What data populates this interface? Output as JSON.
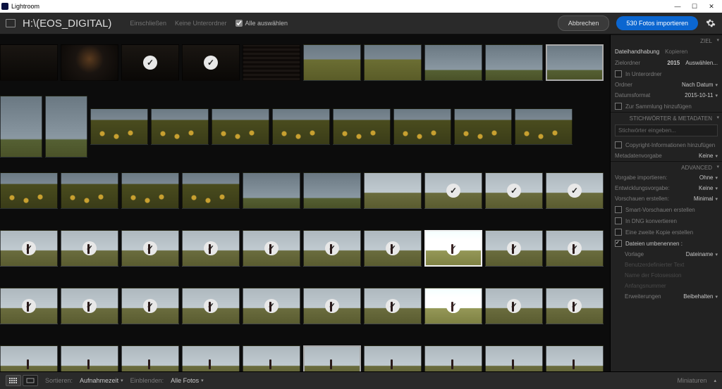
{
  "window": {
    "title": "Lightroom"
  },
  "topbar": {
    "path": "H:\\(EOS_DIGITAL)",
    "include": "Einschließen",
    "no_subfolders": "Keine Unterordner",
    "select_all": "Alle auswählen",
    "cancel": "Abbrechen",
    "import": "530 Fotos importieren"
  },
  "thumbs": {
    "rows": [
      [
        {
          "tex": "t-dark"
        },
        {
          "tex": "t-lamp"
        },
        {
          "tex": "t-dark",
          "check": true
        },
        {
          "tex": "t-dark",
          "check": true
        },
        {
          "tex": "t-mixer"
        },
        {
          "tex": "t-field"
        },
        {
          "tex": "t-field"
        },
        {
          "tex": "t-sky"
        },
        {
          "tex": "t-sky"
        },
        {
          "tex": "t-sky",
          "sel": true
        }
      ],
      [
        {
          "tex": "t-sky",
          "tall": true
        },
        {
          "tex": "t-sky",
          "tall": true
        },
        {
          "tex": "t-flowers"
        },
        {
          "tex": "t-flowers"
        },
        {
          "tex": "t-flowers"
        },
        {
          "tex": "t-flowers"
        },
        {
          "tex": "t-flowers"
        },
        {
          "tex": "t-flowers"
        },
        {
          "tex": "t-flowers"
        },
        {
          "tex": "t-flowers"
        }
      ],
      [
        {
          "tex": "t-flowers"
        },
        {
          "tex": "t-flowers"
        },
        {
          "tex": "t-flowers"
        },
        {
          "tex": "t-flowers"
        },
        {
          "tex": "t-sky"
        },
        {
          "tex": "t-sky"
        },
        {
          "tex": "t-path"
        },
        {
          "tex": "t-path",
          "check": true
        },
        {
          "tex": "t-path",
          "check": true
        },
        {
          "tex": "t-path",
          "check": true
        }
      ],
      [
        {
          "tex": "t-pathperson",
          "check": true
        },
        {
          "tex": "t-pathperson",
          "check": true
        },
        {
          "tex": "t-pathperson",
          "check": true
        },
        {
          "tex": "t-pathperson",
          "check": true
        },
        {
          "tex": "t-pathperson",
          "check": true
        },
        {
          "tex": "t-pathperson",
          "check": true
        },
        {
          "tex": "t-pathperson",
          "check": true
        },
        {
          "tex": "t-pathperson",
          "check": true,
          "bright": true,
          "sel": true
        },
        {
          "tex": "t-pathperson",
          "check": true
        },
        {
          "tex": "t-pathperson",
          "check": true
        }
      ],
      [
        {
          "tex": "t-pathperson",
          "check": true
        },
        {
          "tex": "t-pathperson",
          "check": true
        },
        {
          "tex": "t-pathperson",
          "check": true
        },
        {
          "tex": "t-pathperson",
          "check": true
        },
        {
          "tex": "t-pathperson",
          "check": true
        },
        {
          "tex": "t-pathperson",
          "check": true
        },
        {
          "tex": "t-pathperson",
          "check": true
        },
        {
          "tex": "t-pathperson",
          "check": true,
          "bright": true
        },
        {
          "tex": "t-pathperson",
          "check": true
        },
        {
          "tex": "t-pathperson",
          "check": true
        }
      ],
      [
        {
          "tex": "t-pathperson"
        },
        {
          "tex": "t-pathperson"
        },
        {
          "tex": "t-pathperson"
        },
        {
          "tex": "t-pathperson"
        },
        {
          "tex": "t-pathperson"
        },
        {
          "tex": "t-pathperson",
          "sel": true
        },
        {
          "tex": "t-pathperson"
        },
        {
          "tex": "t-pathperson"
        },
        {
          "tex": "t-pathperson"
        },
        {
          "tex": "t-pathperson"
        }
      ]
    ]
  },
  "panel": {
    "ziel_hdr": "ZIEL",
    "file_handling": "Dateihandhabung",
    "copy": "Kopieren",
    "dest_folder_lbl": "Zielordner",
    "dest_folder_val": "2015",
    "choose": "Auswählen...",
    "in_subfolder": "In Unterordner",
    "folder_lbl": "Ordner",
    "folder_val": "Nach Datum",
    "date_format_lbl": "Datumsformat",
    "date_format_val": "2015-10-11",
    "add_collection": "Zur Sammlung hinzufügen",
    "keywords_hdr": "STICHWÖRTER & METADATEN",
    "keywords_placeholder": "Stichwörter eingeben...",
    "copyright_add": "Copyright-Informationen hinzufügen",
    "meta_preset_lbl": "Metadatenvorgabe",
    "meta_preset_val": "Keine",
    "advanced_hdr": "ADVANCED",
    "import_preset_lbl": "Vorgabe importieren:",
    "import_preset_val": "Ohne",
    "dev_preset_lbl": "Entwicklungsvorgabe:",
    "dev_preset_val": "Keine",
    "previews_lbl": "Vorschauen erstellen:",
    "previews_val": "Minimal",
    "smart_previews": "Smart-Vorschauen erstellen",
    "dng": "In DNG konvertieren",
    "second_copy": "Eine zweite Kopie erstellen",
    "rename": "Dateien umbenennen :",
    "template_lbl": "Vorlage",
    "template_val": "Dateiname",
    "custom_text": "Benutzerdefinierter Text",
    "shoot_name": "Name der Fotosession",
    "start_num": "Anfangsnummer",
    "ext_lbl": "Erweiterungen",
    "ext_val": "Beibehalten"
  },
  "footer": {
    "sort_lbl": "Sortieren:",
    "sort_val": "Aufnahmezeit",
    "filter_lbl": "Einblenden:",
    "filter_val": "Alle Fotos",
    "thumbnails": "Miniaturen"
  }
}
